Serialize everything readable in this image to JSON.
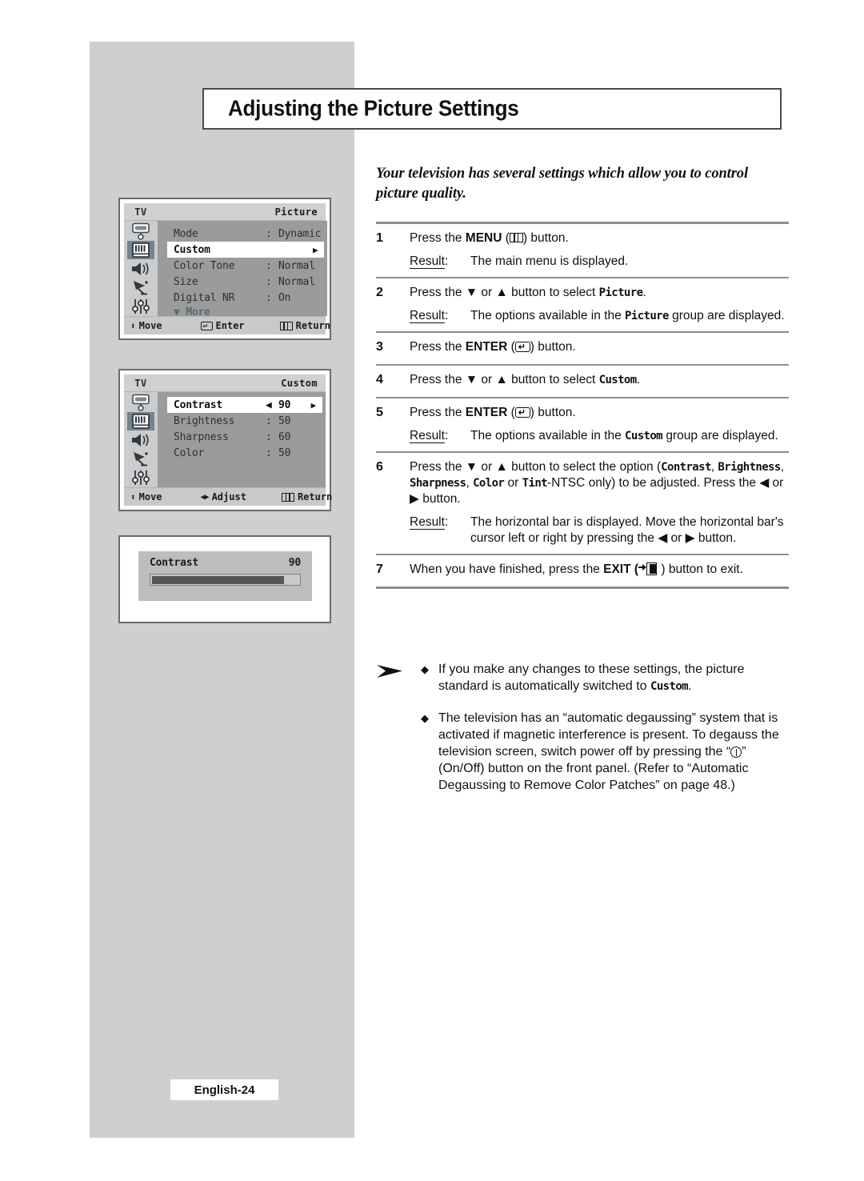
{
  "page": {
    "title": "Adjusting the Picture Settings",
    "intro": "Your television has several settings which allow you to control picture quality.",
    "footer": "English-24"
  },
  "osd_picture": {
    "tv_label": "TV",
    "title": "Picture",
    "rows": [
      {
        "label": "Mode",
        "colon": ":",
        "value": "Dynamic",
        "highlighted": false,
        "caret": ""
      },
      {
        "label": "Custom",
        "colon": "",
        "value": "",
        "highlighted": true,
        "caret": "▶"
      },
      {
        "label": "Color Tone",
        "colon": ":",
        "value": "Normal",
        "highlighted": false,
        "caret": ""
      },
      {
        "label": "Size",
        "colon": ":",
        "value": "Normal",
        "highlighted": false,
        "caret": ""
      },
      {
        "label": "Digital NR",
        "colon": ":",
        "value": "On",
        "highlighted": false,
        "caret": ""
      }
    ],
    "more": "▼ More",
    "footer": {
      "move": "Move",
      "enter": "Enter",
      "return": "Return"
    },
    "rail_icons": [
      "channel-icon",
      "picture-icon",
      "sound-icon",
      "satellite-icon",
      "setup-icon"
    ],
    "active_rail_index": 1
  },
  "osd_custom": {
    "tv_label": "TV",
    "title": "Custom",
    "rows": [
      {
        "label": "Contrast",
        "colon": "◀",
        "value": "90",
        "highlighted": true,
        "caret": "▶"
      },
      {
        "label": "Brightness",
        "colon": ":",
        "value": "50",
        "highlighted": false,
        "caret": ""
      },
      {
        "label": "Sharpness",
        "colon": ":",
        "value": "60",
        "highlighted": false,
        "caret": ""
      },
      {
        "label": "Color",
        "colon": ":",
        "value": "50",
        "highlighted": false,
        "caret": ""
      }
    ],
    "footer": {
      "move": "Move",
      "adjust": "Adjust",
      "return": "Return"
    },
    "rail_icons": [
      "channel-icon",
      "picture-icon",
      "sound-icon",
      "satellite-icon",
      "setup-icon"
    ],
    "active_rail_index": 1
  },
  "osd_bar": {
    "label": "Contrast",
    "value": "90",
    "percent": 90
  },
  "steps": [
    {
      "num": "1",
      "line_pre": "Press the ",
      "bold": "MENU",
      "glyph": "menu-icon",
      "line_post": " button.",
      "results": [
        {
          "label": "Result",
          "text_parts": [
            {
              "t": "The main menu is displayed."
            }
          ]
        }
      ]
    },
    {
      "num": "2",
      "line_pre": "Press the ▼ or ▲ button to select ",
      "mono": "Picture",
      "line_post": ".",
      "results": [
        {
          "label": "Result",
          "text_parts": [
            {
              "t": "The options available in the "
            },
            {
              "t": "Picture",
              "mono": true
            },
            {
              "t": " group are displayed."
            }
          ]
        }
      ]
    },
    {
      "num": "3",
      "line_pre": "Press the ",
      "bold": "ENTER",
      "glyph": "enter-icon",
      "line_post": " button.",
      "results": []
    },
    {
      "num": "4",
      "line_pre": "Press the ▼ or ▲ button to select ",
      "mono": "Custom",
      "line_post": ".",
      "results": []
    },
    {
      "num": "5",
      "line_pre": "Press the ",
      "bold": "ENTER",
      "glyph": "enter-icon",
      "line_post": " button.",
      "results": [
        {
          "label": "Result",
          "text_parts": [
            {
              "t": "The options available in the "
            },
            {
              "t": "Custom",
              "mono": true
            },
            {
              "t": " group are displayed."
            }
          ]
        }
      ]
    },
    {
      "num": "6",
      "results": [
        {
          "label": "Result",
          "text_parts": [
            {
              "t": "The horizontal bar is displayed. Move the horizontal bar's cursor left or right by pressing the ◀ or ▶ button."
            }
          ]
        }
      ]
    },
    {
      "num": "7",
      "results": []
    }
  ],
  "step6": {
    "p1": "Press the ▼ or ▲ button to select the option (",
    "m1": "Contrast",
    "p2": ", ",
    "m2": "Brightness",
    "p3": ", ",
    "m3": "Sharpness",
    "p4": ", ",
    "m4": "Color",
    "p5": " or ",
    "m5": "Tint",
    "p6": "-NTSC only) to be adjusted. Press the ◀ or ▶ button."
  },
  "step7": {
    "pre": "When you have finished, press the ",
    "bold": "EXIT (",
    "post": " ) button to exit."
  },
  "notes": [
    {
      "bullet": "◆",
      "parts": [
        {
          "t": "If you make any changes to these settings, the picture standard is automatically switched to "
        },
        {
          "t": "Custom",
          "mono": true
        },
        {
          "t": "."
        }
      ]
    },
    {
      "bullet": "◆",
      "parts": [
        {
          "t": "The television has an “automatic degaussing” system that is activated if magnetic interference is present. To degauss the television screen, switch power off by pressing the “"
        },
        {
          "t": "Ⓘ",
          "power": true
        },
        {
          "t": "” (On/Off) button on the front panel. (Refer to “Automatic Degaussing to Remove Color Patches” on page 48.)"
        }
      ]
    }
  ],
  "colors": {
    "page_panel": "#cfcfcf",
    "rule": "#8d8d8d",
    "osd_body": "#9b9b9b",
    "osd_rail": "#cccccc",
    "osd_rail_active": "#74838e",
    "osd_more_text": "#5b6a74",
    "bar_fill": "#555555"
  }
}
